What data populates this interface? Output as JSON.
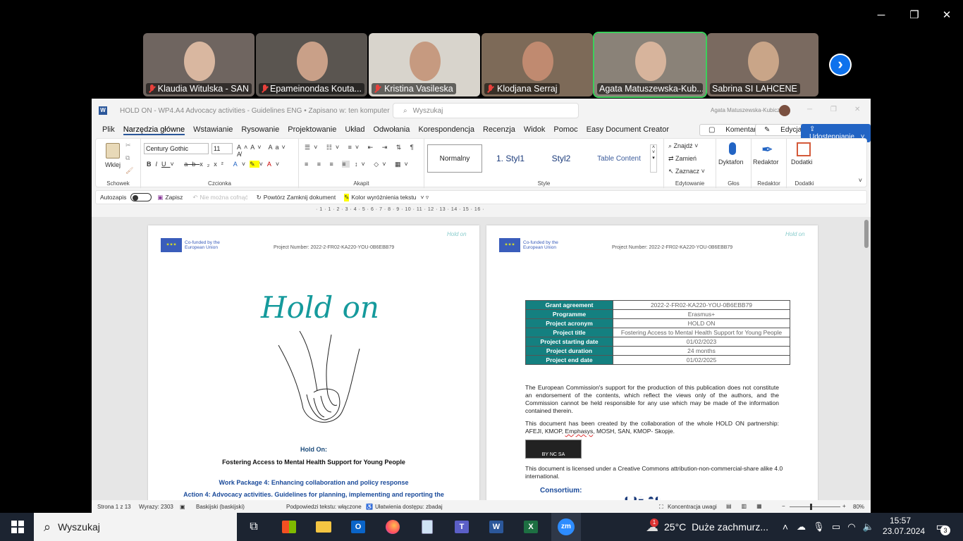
{
  "zoom_bar": {
    "minimize": "─",
    "restore": "❐",
    "close": "✕",
    "next": "›"
  },
  "participants": [
    {
      "name": "Klaudia Witulska - SAN",
      "muted": true
    },
    {
      "name": "Epameinondas Kouta...",
      "muted": true
    },
    {
      "name": "Kristina Vasileska",
      "muted": true
    },
    {
      "name": "Klodjana Serraj",
      "muted": true
    },
    {
      "name": "Agata Matuszewska-Kub...",
      "muted": false
    },
    {
      "name": "Sabrina SI LAHCENE",
      "muted": false
    }
  ],
  "word": {
    "title": "HOLD ON - WP4.A4 Advocacy activities - Guidelines ENG • Zapisano w: ten komputer",
    "search_placeholder": "Wyszukaj",
    "user": "Agata Matuszewska-Kubicz",
    "tabs": [
      "Plik",
      "Narzędzia główne",
      "Wstawianie",
      "Rysowanie",
      "Projektowanie",
      "Układ",
      "Odwołania",
      "Korespondencja",
      "Recenzja",
      "Widok",
      "Pomoc",
      "Easy Document Creator"
    ],
    "comments": "Komentarze",
    "editing": "Edycja",
    "share": "Udostępnianie",
    "ribbon": {
      "paste": "Wklej",
      "clipboard": "Schowek",
      "font": "Century Gothic",
      "size": "11",
      "font_group": "Czcionka",
      "para_group": "Akapit",
      "styles": [
        "Normalny",
        "1. Styl1",
        "Styl2",
        "Table Content"
      ],
      "styles_group": "Style",
      "find": "Znajdź",
      "replace": "Zamień",
      "select": "Zaznacz",
      "editing_group": "Edytowanie",
      "dictate": "Dyktafon",
      "voice_group": "Głos",
      "editor": "Redaktor",
      "editor_group": "Redaktor",
      "addins": "Dodatki",
      "addins_group": "Dodatki"
    },
    "qat": {
      "autosave": "Autozapis",
      "save": "Zapisz",
      "undo": "Nie można cofnąć",
      "redo": "Powtórz Zamknij dokument",
      "highlight": "Kolor wyróżnienia tekstu"
    },
    "ruler": "· 1 · 1 · 2 · 3 · 4 · 5 · 6 · 7 · 8 · 9 · 10 · 11 · 12 · 13 · 14 · 15 · 16 ·",
    "page1": {
      "eu": "Co-funded by the European Union",
      "project_number": "Project Number: 2022-2-FR02-KA220-YOU-0B6EBB79",
      "logo": "Hold on",
      "small_logo": "Hold on",
      "hold_on": "Hold On:",
      "subtitle": "Fostering Access to Mental Health Support for Young People",
      "wp": "Work Package 4: Enhancing collaboration and policy response",
      "action": "Action 4: Advocacy activities. Guidelines for planning, implementing and reporting the"
    },
    "page2": {
      "rows": [
        {
          "k": "Grant agreement",
          "v": "2022-2-FR02-KA220-YOU-0B6EBB79"
        },
        {
          "k": "Programme",
          "v": "Erasmus+"
        },
        {
          "k": "Project acronym",
          "v": "HOLD ON"
        },
        {
          "k": "Project title",
          "v": "Fostering Access to Mental Health Support for Young People"
        },
        {
          "k": "Project starting date",
          "v": "01/02/2023"
        },
        {
          "k": "Project duration",
          "v": "24 months"
        },
        {
          "k": "Project end date",
          "v": "01/02/2025"
        }
      ],
      "para1": "The European Commission's support for the production of this publication does not constitute an endorsement of the contents, which reflect the views only of the authors, and the Commission cannot be held responsible for any use which may be made of the information contained therein.",
      "para2a": "This document has been created by the collaboration of the whole HOLD ON partnership: AFEJI, KMOP, ",
      "para2b": "Emphasys",
      "para2c": ", MOSH, SAN, KMOP- Skopje.",
      "cc": "BY  NC  SA",
      "para3": "This document is licensed under a Creative Commons attribution-non-commercial-share alike 4.0 international.",
      "consortium": "Consortium:"
    },
    "status": {
      "page": "Strona 1 z 13",
      "words": "Wyrazy: 2303",
      "lang": "Baskijski (baskijski)",
      "predict": "Podpowiedzi tekstu: włączone",
      "access": "Ułatwienia dostępu: zbadaj",
      "focus": "Koncentracja uwagi",
      "zoom": "80%",
      "zoom_value": 0.8
    }
  },
  "taskbar": {
    "search": "Wyszukaj",
    "weather_badge": "1",
    "temp": "25°C",
    "weather": "Duże zachmurz...",
    "time": "15:57",
    "date": "23.07.2024",
    "notif": "3"
  }
}
